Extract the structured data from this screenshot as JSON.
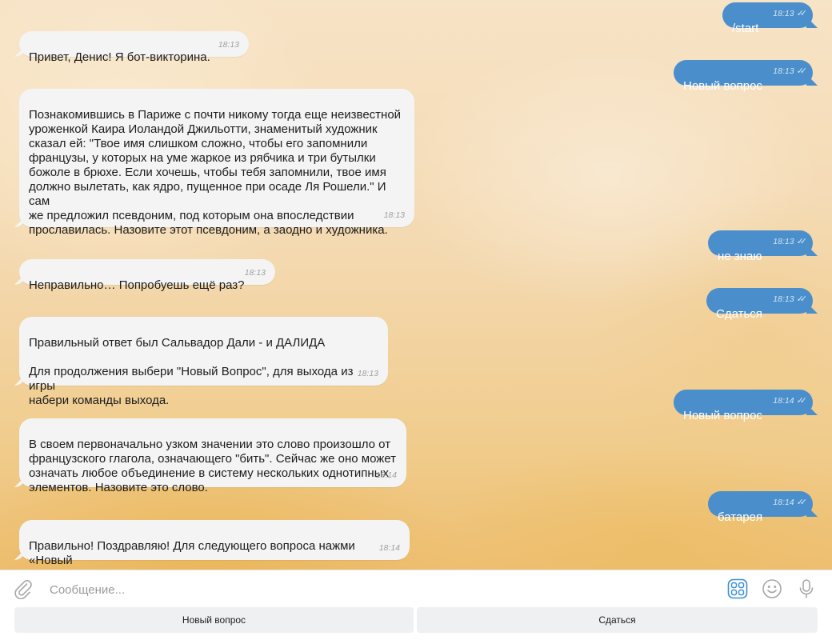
{
  "messages": [
    {
      "dir": "out",
      "text": "/start",
      "time": "18:13"
    },
    {
      "dir": "in",
      "text": "Привет, Денис! Я бот-викторина.",
      "time": "18:13"
    },
    {
      "dir": "out",
      "text": "Новый вопрос",
      "time": "18:13"
    },
    {
      "dir": "in",
      "text": "Познакомившись в Париже с почти никому тогда еще неизвестной\nуроженкой Каира Иоландой Джильотти, знаменитый художник\nсказал ей: \"Твое имя слишком сложно, чтобы его запомнили\nфранцузы, у которых на уме жаркое из рябчика и три бутылки\nбожоле в брюхе. Если хочешь, чтобы тебя запомнили, твое имя\nдолжно вылетать, как ядро, пущенное при осаде Ля Рошели.\" И сам\nже предложил псевдоним, под которым она впоследствии\nпрославилась. Назовите этот псевдоним, а заодно и художника.",
      "time": "18:13"
    },
    {
      "dir": "out",
      "text": "не знаю",
      "time": "18:13"
    },
    {
      "dir": "in",
      "text": "Неправильно… Попробуешь ещё раз?",
      "time": "18:13"
    },
    {
      "dir": "out",
      "text": "Сдаться",
      "time": "18:13"
    },
    {
      "dir": "in",
      "text": "Правильный ответ был Сальвадор Дали - и ДАЛИДА\n\nДля продолжения выбери \"Новый Вопрос\", для выхода из игры\nнабери команды выхода.",
      "time": "18:13"
    },
    {
      "dir": "out",
      "text": "Новый вопрос",
      "time": "18:14"
    },
    {
      "dir": "in",
      "text": "В своем первоначально узком значении это слово произошло от\nфранцузского глагола, означающего \"бить\". Сейчас же оно может\nозначать любое объединение в систему нескольких однотипных\nэлементов. Назовите это слово.",
      "time": "18:14"
    },
    {
      "dir": "out",
      "text": "батарея",
      "time": "18:14"
    },
    {
      "dir": "in",
      "text": "Правильно! Поздравляю! Для следующего вопроса нажми «Новый\nвопрос»",
      "time": "18:14"
    }
  ],
  "composer": {
    "placeholder": "Сообщение...",
    "attach_icon": "paperclip-icon",
    "sticker_icon": "bot-keyboard-icon",
    "emoji_icon": "emoji-icon",
    "mic_icon": "microphone-icon"
  },
  "keyboard": {
    "buttons": [
      "Новый вопрос",
      "Сдаться"
    ]
  },
  "colors": {
    "outgoing_bubble": "#4a8fcb",
    "incoming_bubble": "#f4f4f4",
    "bot_keyboard_icon": "#3d8fd6"
  }
}
